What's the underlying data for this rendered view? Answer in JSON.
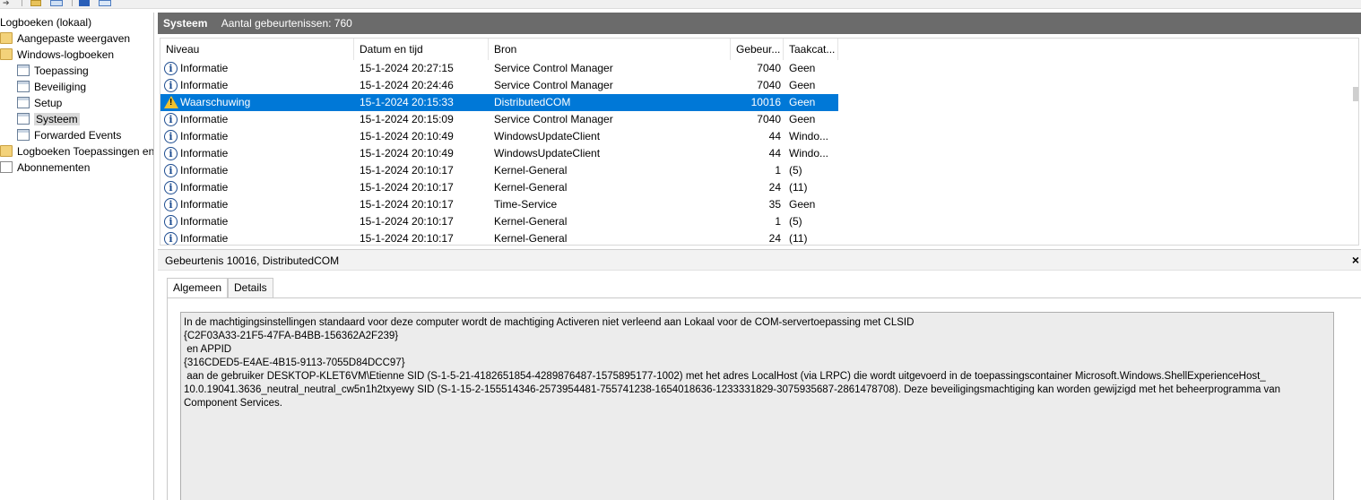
{
  "tree": {
    "items": [
      {
        "label": "Logboeken (lokaal)",
        "icon": "computer-icon"
      },
      {
        "label": "Aangepaste weergaven",
        "icon": "folder-icon"
      },
      {
        "label": "Windows-logboeken",
        "icon": "folder-icon"
      },
      {
        "label": "Toepassing",
        "icon": "log-icon"
      },
      {
        "label": "Beveiliging",
        "icon": "log-icon"
      },
      {
        "label": "Setup",
        "icon": "log-icon"
      },
      {
        "label": "Systeem",
        "icon": "log-icon",
        "selected": true
      },
      {
        "label": "Forwarded Events",
        "icon": "log-icon"
      },
      {
        "label": "Logboeken Toepassingen en",
        "icon": "folder-icon"
      },
      {
        "label": "Abonnementen",
        "icon": "subscription-icon"
      }
    ]
  },
  "header": {
    "title": "Systeem",
    "count_text": "Aantal gebeurtenissen: 760"
  },
  "table": {
    "columns": [
      "Niveau",
      "Datum en tijd",
      "Bron",
      "Gebeur...",
      "Taakcat..."
    ],
    "rows": [
      {
        "level": "Informatie",
        "datetime": "15-1-2024 20:27:15",
        "source": "Service Control Manager",
        "event_id": "7040",
        "task": "Geen"
      },
      {
        "level": "Informatie",
        "datetime": "15-1-2024 20:24:46",
        "source": "Service Control Manager",
        "event_id": "7040",
        "task": "Geen"
      },
      {
        "level": "Waarschuwing",
        "datetime": "15-1-2024 20:15:33",
        "source": "DistributedCOM",
        "event_id": "10016",
        "task": "Geen",
        "selected": true
      },
      {
        "level": "Informatie",
        "datetime": "15-1-2024 20:15:09",
        "source": "Service Control Manager",
        "event_id": "7040",
        "task": "Geen"
      },
      {
        "level": "Informatie",
        "datetime": "15-1-2024 20:10:49",
        "source": "WindowsUpdateClient",
        "event_id": "44",
        "task": "Windo..."
      },
      {
        "level": "Informatie",
        "datetime": "15-1-2024 20:10:49",
        "source": "WindowsUpdateClient",
        "event_id": "44",
        "task": "Windo..."
      },
      {
        "level": "Informatie",
        "datetime": "15-1-2024 20:10:17",
        "source": "Kernel-General",
        "event_id": "1",
        "task": "(5)"
      },
      {
        "level": "Informatie",
        "datetime": "15-1-2024 20:10:17",
        "source": "Kernel-General",
        "event_id": "24",
        "task": "(11)"
      },
      {
        "level": "Informatie",
        "datetime": "15-1-2024 20:10:17",
        "source": "Time-Service",
        "event_id": "35",
        "task": "Geen"
      },
      {
        "level": "Informatie",
        "datetime": "15-1-2024 20:10:17",
        "source": "Kernel-General",
        "event_id": "1",
        "task": "(5)"
      },
      {
        "level": "Informatie",
        "datetime": "15-1-2024 20:10:17",
        "source": "Kernel-General",
        "event_id": "24",
        "task": "(11)"
      }
    ]
  },
  "details": {
    "title": "Gebeurtenis 10016, DistributedCOM",
    "close": "×",
    "tabs": [
      "Algemeen",
      "Details"
    ],
    "active_tab": "Algemeen",
    "text": "In de machtigingsinstellingen standaard voor deze computer wordt de machtiging Activeren niet verleend aan Lokaal voor de COM-servertoepassing met CLSID\n{C2F03A33-21F5-47FA-B4BB-156362A2F239}\n en APPID\n{316CDED5-E4AE-4B15-9113-7055D84DCC97}\n aan de gebruiker DESKTOP-KLET6VM\\Etienne SID (S-1-5-21-4182651854-4289876487-1575895177-1002) met het adres LocalHost (via LRPC) die wordt uitgevoerd in de toepassingscontainer Microsoft.Windows.ShellExperienceHost_\n10.0.19041.3636_neutral_neutral_cw5n1h2txyewy SID (S-1-15-2-155514346-2573954481-755741238-1654018636-1233331829-3075935687-2861478708). Deze beveiligingsmachtiging kan worden gewijzigd met het beheerprogramma van\nComponent Services."
  },
  "colors": {
    "selection": "#0078d7",
    "header_bar": "#6b6b6b",
    "warning": "#f2c12e"
  }
}
